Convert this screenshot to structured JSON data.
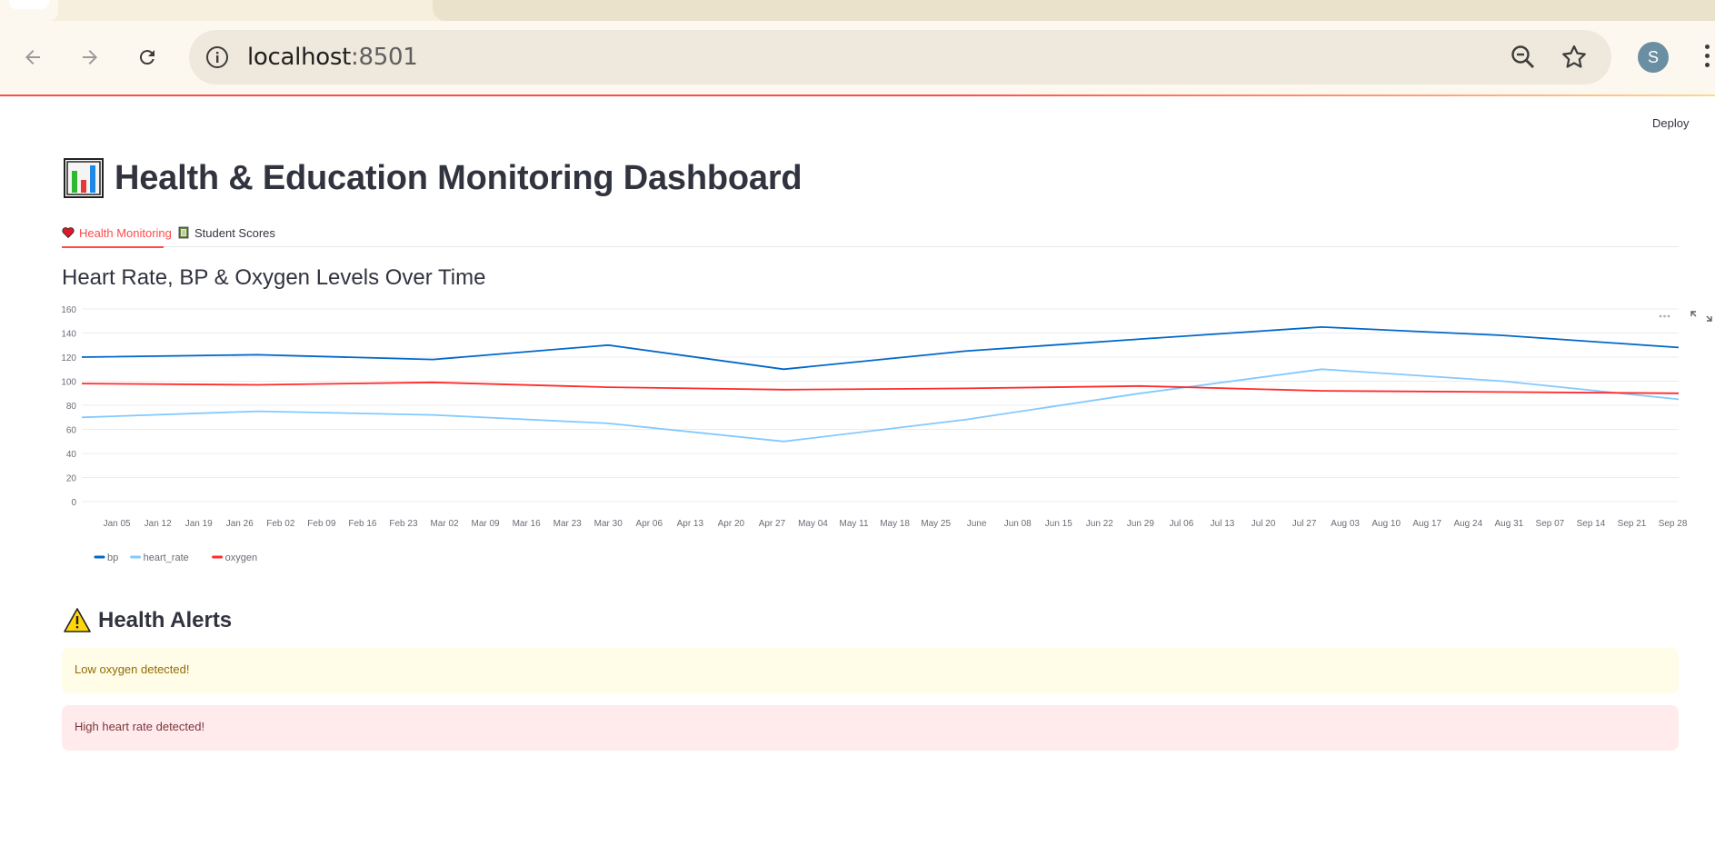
{
  "browser": {
    "url_host": "localhost",
    "url_port": ":8501",
    "avatar_letter": "S"
  },
  "app": {
    "deploy_label": "Deploy",
    "title": "Health & Education Monitoring Dashboard",
    "tabs": [
      {
        "label": "Health Monitoring",
        "icon": "heart-icon",
        "active": true
      },
      {
        "label": "Student Scores",
        "icon": "notebook-icon",
        "active": false
      }
    ],
    "chart_heading": "Heart Rate, BP & Oxygen Levels Over Time",
    "alerts_heading": "Health Alerts",
    "alerts": [
      {
        "type": "warning",
        "text": "Low oxygen detected!"
      },
      {
        "type": "error",
        "text": "High heart rate detected!"
      }
    ]
  },
  "colors": {
    "accent": "#ff4b4b",
    "bp": "#0068c9",
    "heart_rate": "#83c9ff",
    "oxygen": "#ff2b2b"
  },
  "chart_data": {
    "type": "line",
    "title": "Heart Rate, BP & Oxygen Levels Over Time",
    "xlabel": "",
    "ylabel": "",
    "ylim": [
      0,
      160
    ],
    "yticks": [
      0,
      20,
      40,
      60,
      80,
      100,
      120,
      140,
      160
    ],
    "grid": true,
    "legend_position": "bottom-left",
    "x_tick_labels": [
      "Jan 05",
      "Jan 12",
      "Jan 19",
      "Jan 26",
      "Feb 02",
      "Feb 09",
      "Feb 16",
      "Feb 23",
      "Mar 02",
      "Mar 09",
      "Mar 16",
      "Mar 23",
      "Mar 30",
      "Apr 06",
      "Apr 13",
      "Apr 20",
      "Apr 27",
      "May 04",
      "May 11",
      "May 18",
      "May 25",
      "June",
      "Jun 08",
      "Jun 15",
      "Jun 22",
      "Jun 29",
      "Jul 06",
      "Jul 13",
      "Jul 20",
      "Jul 27",
      "Aug 03",
      "Aug 10",
      "Aug 17",
      "Aug 24",
      "Aug 31",
      "Sep 07",
      "Sep 14",
      "Sep 21",
      "Sep 28"
    ],
    "x": [
      "2024-01-01",
      "2024-01-31",
      "2024-03-01",
      "2024-03-31",
      "2024-04-30",
      "2024-05-31",
      "2024-06-30",
      "2024-07-31",
      "2024-08-31",
      "2024-09-30"
    ],
    "series": [
      {
        "name": "bp",
        "color": "#0068c9",
        "values": [
          120,
          122,
          118,
          130,
          110,
          125,
          135,
          145,
          138,
          128
        ]
      },
      {
        "name": "heart_rate",
        "color": "#83c9ff",
        "values": [
          70,
          75,
          72,
          65,
          50,
          68,
          90,
          110,
          100,
          85
        ]
      },
      {
        "name": "oxygen",
        "color": "#ff2b2b",
        "values": [
          98,
          97,
          99,
          95,
          93,
          94,
          96,
          92,
          91,
          90
        ]
      }
    ]
  }
}
